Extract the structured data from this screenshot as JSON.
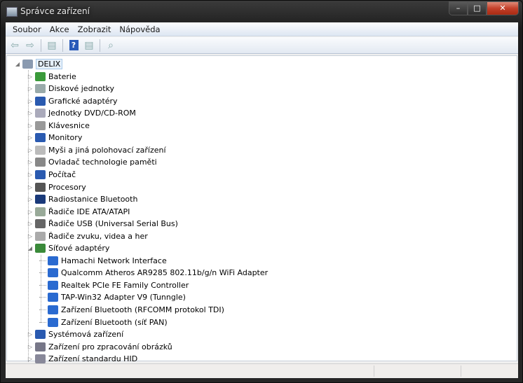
{
  "window": {
    "title": "Správce zařízení",
    "minimize": "–",
    "maximize": "□",
    "close": "✕"
  },
  "menu": [
    "Soubor",
    "Akce",
    "Zobrazit",
    "Nápověda"
  ],
  "toolbar": [
    {
      "name": "back-icon",
      "glyph": "⇦"
    },
    {
      "name": "forward-icon",
      "glyph": "⇨"
    },
    {
      "name": "show-hide-console-tree-icon",
      "glyph": "▤"
    },
    {
      "name": "help-icon",
      "glyph": "?"
    },
    {
      "name": "properties-icon",
      "glyph": "▤"
    },
    {
      "name": "scan-hardware-icon",
      "glyph": "⌕"
    }
  ],
  "tree": {
    "root": "DELIX",
    "items": [
      {
        "label": "Baterie",
        "icon": "#3a9a3a"
      },
      {
        "label": "Diskové jednotky",
        "icon": "#9aa"
      },
      {
        "label": "Grafické adaptéry",
        "icon": "#2a5ab0"
      },
      {
        "label": "Jednotky DVD/CD-ROM",
        "icon": "#aab"
      },
      {
        "label": "Klávesnice",
        "icon": "#999"
      },
      {
        "label": "Monitory",
        "icon": "#2a5ab0"
      },
      {
        "label": "Myši a jiná polohovací zařízení",
        "icon": "#bbb"
      },
      {
        "label": "Ovladač technologie paměti",
        "icon": "#888"
      },
      {
        "label": "Počítač",
        "icon": "#2a5ab0"
      },
      {
        "label": "Procesory",
        "icon": "#555"
      },
      {
        "label": "Radiostanice Bluetooth",
        "icon": "#1a3a7a"
      },
      {
        "label": "Řadiče IDE ATA/ATAPI",
        "icon": "#9a9"
      },
      {
        "label": "Řadiče USB (Universal Serial Bus)",
        "icon": "#666"
      },
      {
        "label": "Řadiče zvuku, videa a her",
        "icon": "#aaa"
      },
      {
        "label": "Síťové adaptéry",
        "icon": "#3a8a3a",
        "expanded": true,
        "children": [
          "Hamachi Network Interface",
          "Qualcomm Atheros AR9285 802.11b/g/n WiFi Adapter",
          "Realtek PCIe FE Family Controller",
          "TAP-Win32 Adapter V9 (Tunngle)",
          "Zařízení Bluetooth (RFCOMM protokol TDI)",
          "Zařízení Bluetooth (síť PAN)"
        ]
      },
      {
        "label": "Systémová zařízení",
        "icon": "#2a5ab0"
      },
      {
        "label": "Zařízení pro zpracování obrázků",
        "icon": "#778"
      },
      {
        "label": "Zařízení standardu HID",
        "icon": "#889"
      }
    ]
  },
  "colors": {
    "net": "#2a6ad0"
  }
}
